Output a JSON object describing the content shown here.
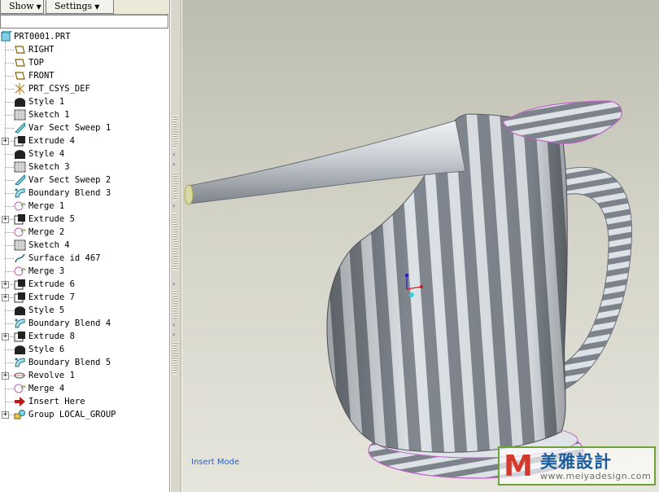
{
  "toolbar": {
    "show_label": "Show",
    "settings_label": "Settings"
  },
  "tree": {
    "root": "PRT0001.PRT",
    "items": [
      {
        "label": "RIGHT",
        "icon": "datum-plane-icon",
        "expandable": false
      },
      {
        "label": "TOP",
        "icon": "datum-plane-icon",
        "expandable": false
      },
      {
        "label": "FRONT",
        "icon": "datum-plane-icon",
        "expandable": false
      },
      {
        "label": "PRT_CSYS_DEF",
        "icon": "coordinate-system-icon",
        "expandable": false
      },
      {
        "label": "Style 1",
        "icon": "style-icon",
        "expandable": false
      },
      {
        "label": "Sketch 1",
        "icon": "sketch-icon",
        "expandable": false
      },
      {
        "label": "Var Sect Sweep 1",
        "icon": "sweep-icon",
        "expandable": false
      },
      {
        "label": "Extrude 4",
        "icon": "extrude-icon",
        "expandable": true
      },
      {
        "label": "Style 4",
        "icon": "style-icon",
        "expandable": false
      },
      {
        "label": "Sketch 3",
        "icon": "sketch-icon",
        "expandable": false
      },
      {
        "label": "Var Sect Sweep 2",
        "icon": "sweep-icon",
        "expandable": false
      },
      {
        "label": "Boundary Blend 3",
        "icon": "boundary-blend-icon",
        "expandable": false
      },
      {
        "label": "Merge 1",
        "icon": "merge-icon",
        "expandable": false
      },
      {
        "label": "Extrude 5",
        "icon": "extrude-icon",
        "expandable": true
      },
      {
        "label": "Merge 2",
        "icon": "merge-icon",
        "expandable": false
      },
      {
        "label": "Sketch 4",
        "icon": "sketch-icon",
        "expandable": false
      },
      {
        "label": "Surface id 467",
        "icon": "surface-icon",
        "expandable": false
      },
      {
        "label": "Merge 3",
        "icon": "merge-icon",
        "expandable": false
      },
      {
        "label": "Extrude 6",
        "icon": "extrude-icon",
        "expandable": true
      },
      {
        "label": "Extrude 7",
        "icon": "extrude-icon",
        "expandable": true
      },
      {
        "label": "Style 5",
        "icon": "style-icon",
        "expandable": false
      },
      {
        "label": "Boundary Blend 4",
        "icon": "boundary-blend-icon",
        "expandable": false
      },
      {
        "label": "Extrude 8",
        "icon": "extrude-icon",
        "expandable": true
      },
      {
        "label": "Style 6",
        "icon": "style-icon",
        "expandable": false
      },
      {
        "label": "Boundary Blend 5",
        "icon": "boundary-blend-icon",
        "expandable": false
      },
      {
        "label": "Revolve 1",
        "icon": "revolve-icon",
        "expandable": true
      },
      {
        "label": "Merge 4",
        "icon": "merge-icon",
        "expandable": false
      },
      {
        "label": "Insert Here",
        "icon": "insert-arrow-icon",
        "expandable": false
      },
      {
        "label": "Group LOCAL_GROUP",
        "icon": "group-icon",
        "expandable": true
      }
    ]
  },
  "viewport": {
    "mode_label": "Insert Mode"
  },
  "watermark": {
    "logo": "M",
    "title": "美雅設計",
    "url": "www.meiyadesign.com"
  },
  "colors": {
    "accent": "#2c5fbe",
    "splitter_arrow": "#1c2fbf",
    "model_light": "#e2e6ea",
    "model_dark": "#7e858d",
    "edge_highlight": "#c060c8"
  }
}
